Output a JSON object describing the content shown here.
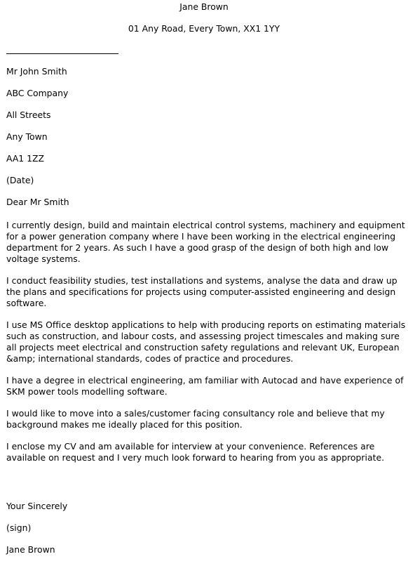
{
  "sender": {
    "name": "Jane Brown",
    "address": "01 Any Road, Every Town, XX1 1YY"
  },
  "recipient": {
    "lines": [
      "Mr John Smith",
      "ABC Company",
      "All Streets",
      "Any Town",
      "AA1 1ZZ",
      "(Date)",
      "Dear Mr Smith"
    ]
  },
  "body": {
    "paragraphs": [
      "I currently design, build and maintain electrical control systems, machinery and equipment for a power generation company where I have been working in the electrical engineering department for 2 years. As such I have a good grasp of the design of both high and low voltage systems.",
      "I conduct feasibility studies, test installations and systems, analyse the data and draw up the plans and specifications for projects using computer-assisted engineering and design software.",
      "I use MS Office desktop applications to help with producing reports on estimating materials such as construction, and labour costs, and assessing project timescales and making sure all projects meet electrical and construction safety regulations and relevant UK, European &amp; international standards, codes of practice and procedures.",
      "I have a degree in electrical engineering, am familiar with Autocad and have experience of SKM power tools modelling software.",
      "I would like to move into a sales/customer facing consultancy role and believe that my background makes me ideally placed for this position.",
      "I enclose my CV and am available for interview at your convenience. References are available on request and I very much look forward to hearing from you as appropriate."
    ]
  },
  "closing": {
    "salutation": "Your Sincerely",
    "signature_placeholder": "(sign)",
    "name": "Jane Brown"
  }
}
